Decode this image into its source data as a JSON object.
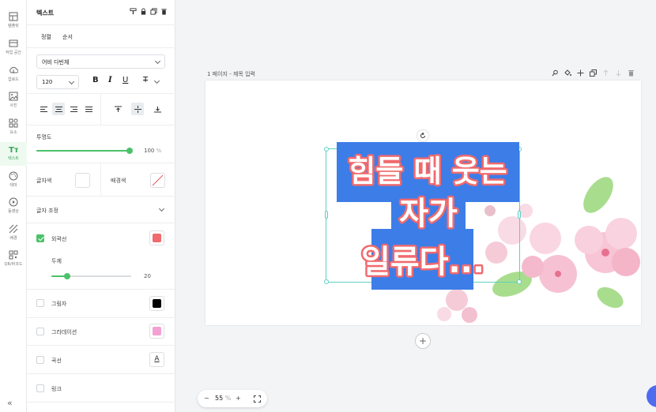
{
  "rail": {
    "items": [
      {
        "label": "템플릿",
        "icon": "template-icon"
      },
      {
        "label": "작업 공간",
        "icon": "workspace-icon"
      },
      {
        "label": "업로드",
        "icon": "upload-icon"
      },
      {
        "label": "사진",
        "icon": "photo-icon"
      },
      {
        "label": "요소",
        "icon": "elements-icon"
      },
      {
        "label": "텍스트",
        "icon": "text-icon"
      },
      {
        "label": "테마",
        "icon": "palette-icon"
      },
      {
        "label": "동영상",
        "icon": "video-icon"
      },
      {
        "label": "배경",
        "icon": "background-icon"
      },
      {
        "label": "QR/바코드",
        "icon": "qr-icon"
      }
    ],
    "active_index": 5,
    "collapse_label": "«"
  },
  "panel": {
    "title": "텍스트",
    "tabs": [
      "정렬",
      "순서"
    ],
    "font_family": "어비 다빈체",
    "font_size": "120",
    "format": {
      "bold": "B",
      "italic": "I",
      "underline": "U",
      "strike": "T"
    },
    "opacity": {
      "label": "투명도",
      "value": "100",
      "unit": "%",
      "level": 1.0
    },
    "text_color": {
      "label": "글자색",
      "value": "#ffffff"
    },
    "bg_color": {
      "label": "배경색"
    },
    "text_adjust": {
      "label": "글자 조정"
    },
    "outline": {
      "label": "외곽선",
      "checked": true,
      "color": "#f06a6e",
      "thickness_label": "두께",
      "thickness": "20",
      "level": 0.2
    },
    "shadow": {
      "label": "그림자",
      "checked": false,
      "color": "#000000"
    },
    "gradient": {
      "label": "그라데이션",
      "checked": false,
      "color": "#f3a0d4"
    },
    "curve": {
      "label": "곡선",
      "checked": false,
      "icon_text": "A"
    },
    "link": {
      "label": "링크",
      "checked": false
    }
  },
  "workspace": {
    "page_label": "1 페이지 - 제목 입력",
    "canvas_text_lines": [
      "힘들 때 웃는",
      "자가",
      "일류다..."
    ],
    "text_highlight": "#3d7de8",
    "text_color": "#ffffff",
    "outline_color": "#f06a6e",
    "add_page": "+",
    "zoom": {
      "minus": "−",
      "value": "55",
      "unit": "%",
      "plus": "+"
    }
  }
}
